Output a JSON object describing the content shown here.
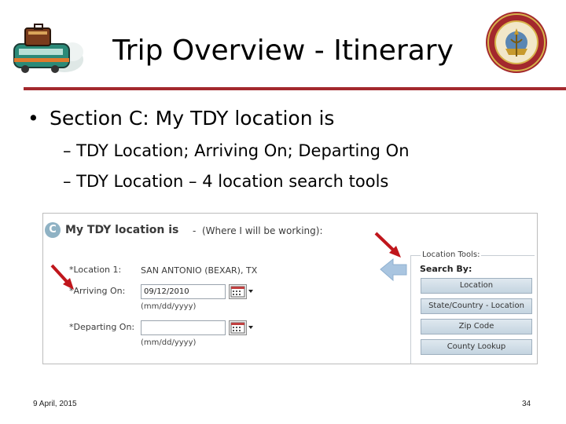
{
  "slide": {
    "title": "Trip Overview - Itinerary",
    "bullet": "Section C: My TDY location is",
    "bullet_marker": "•",
    "subbullets": [
      "– TDY Location; Arriving On; Departing On",
      "– TDY Location – 4 location search tools"
    ],
    "footer_date": "9 April, 2015",
    "page_number": "34",
    "rule_color": "#a3282d"
  },
  "section": {
    "badge": "C",
    "title": "My TDY location is",
    "dash": "-",
    "subtitle": "(Where I will be working):"
  },
  "form": {
    "location_label": "*Location 1:",
    "location_value": "SAN ANTONIO (BEXAR), TX",
    "arriving_label": "*Arriving On:",
    "arriving_value": "09/12/2010",
    "arriving_hint": "(mm/dd/yyyy)",
    "departing_label": "*Departing On:",
    "departing_value": "",
    "departing_hint": "(mm/dd/yyyy)"
  },
  "tools": {
    "legend": "Location Tools:",
    "search_by": "Search By:",
    "buttons": [
      "Location",
      "State/Country - Location",
      "Zip Code",
      "County Lookup"
    ]
  },
  "icons": {
    "left_logo": "train-logo-icon",
    "right_logo": "marine-corps-seal-icon",
    "arrows": [
      "red-arrow-icon",
      "red-arrow-icon",
      "blue-arrow-icon"
    ]
  }
}
